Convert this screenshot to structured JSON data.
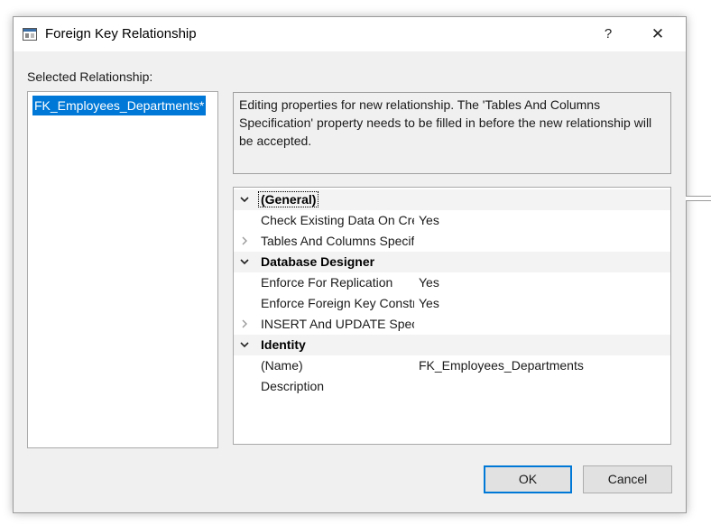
{
  "window": {
    "title": "Foreign Key Relationship",
    "help_label": "?",
    "close_label": "✕"
  },
  "selected_relationship": {
    "label": "Selected Relationship:",
    "items": [
      "FK_Employees_Departments*"
    ]
  },
  "description": "Editing properties for new relationship.  The 'Tables And Columns Specification' property needs to be filled in before the new relationship will be accepted.",
  "property_grid": {
    "categories": [
      {
        "name": "(General)",
        "expanded": true,
        "properties": [
          {
            "name": "Check Existing Data On Creation Or Re-Enabling",
            "value": "Yes"
          },
          {
            "name": "Tables And Columns Specification",
            "value": "",
            "expandable": true
          }
        ]
      },
      {
        "name": "Database Designer",
        "expanded": true,
        "properties": [
          {
            "name": "Enforce For Replication",
            "value": "Yes"
          },
          {
            "name": "Enforce Foreign Key Constraint",
            "value": "Yes"
          },
          {
            "name": "INSERT And UPDATE Specification",
            "value": "",
            "expandable": true
          }
        ]
      },
      {
        "name": "Identity",
        "expanded": true,
        "properties": [
          {
            "name": "(Name)",
            "value": "FK_Employees_Departments"
          },
          {
            "name": "Description",
            "value": ""
          }
        ]
      }
    ]
  },
  "buttons": {
    "ok": "OK",
    "cancel": "Cancel"
  },
  "colors": {
    "selection": "#0078d7",
    "dialog_bg": "#f0f0f0",
    "category_bg": "#f3f3f3"
  }
}
